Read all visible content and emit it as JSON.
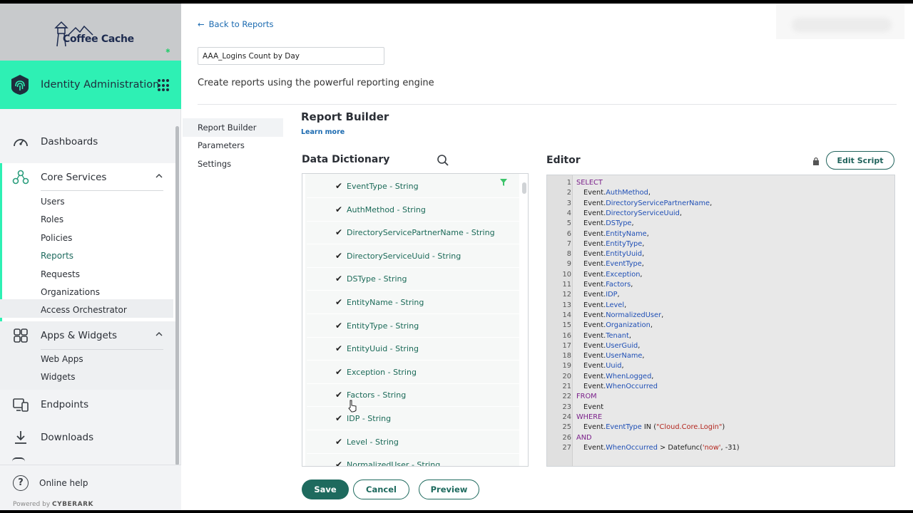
{
  "brand": {
    "logo_text": "Coffee Cache",
    "accent": "#2ef0b4",
    "primary": "#1e6a5e",
    "link": "#1b6ab0"
  },
  "app": {
    "title": "Identity Administration"
  },
  "sidebar": {
    "dashboards": "Dashboards",
    "core_services": {
      "label": "Core Services",
      "items": [
        "Users",
        "Roles",
        "Policies",
        "Reports",
        "Requests",
        "Organizations",
        "Access Orchestrator"
      ],
      "active": "Reports"
    },
    "apps_widgets": {
      "label": "Apps & Widgets",
      "items": [
        "Web Apps",
        "Widgets"
      ]
    },
    "endpoints": "Endpoints",
    "downloads": "Downloads",
    "online_help": "Online help",
    "powered_by": "Powered by",
    "powered_brand": "CYBERARK"
  },
  "main": {
    "back_link": "Back to Reports",
    "report_name": "AAA_Logins Count by Day",
    "subtitle": "Create reports using the powerful reporting engine",
    "tabs": [
      "Report Builder",
      "Parameters",
      "Settings"
    ],
    "active_tab": "Report Builder",
    "builder_title": "Report Builder",
    "learn_more": "Learn more",
    "data_dictionary": {
      "title": "Data Dictionary",
      "fields": [
        "EventType - String",
        "AuthMethod - String",
        "DirectoryServicePartnerName - String",
        "DirectoryServiceUuid - String",
        "DSType - String",
        "EntityName - String",
        "EntityType - String",
        "EntityUuid - String",
        "Exception - String",
        "Factors - String",
        "IDP - String",
        "Level - String",
        "NormalizedUser - String"
      ]
    },
    "editor": {
      "title": "Editor",
      "edit_script": "Edit Script",
      "lines": [
        {
          "n": "1",
          "kw": "SELECT",
          "code": ""
        },
        {
          "n": "2",
          "kw": "",
          "obj": "Event.",
          "fld": "AuthMethod",
          "tail": ","
        },
        {
          "n": "3",
          "kw": "",
          "obj": "Event.",
          "fld": "DirectoryServicePartnerName",
          "tail": ","
        },
        {
          "n": "4",
          "kw": "",
          "obj": "Event.",
          "fld": "DirectoryServiceUuid",
          "tail": ","
        },
        {
          "n": "5",
          "kw": "",
          "obj": "Event.",
          "fld": "DSType",
          "tail": ","
        },
        {
          "n": "6",
          "kw": "",
          "obj": "Event.",
          "fld": "EntityName",
          "tail": ","
        },
        {
          "n": "7",
          "kw": "",
          "obj": "Event.",
          "fld": "EntityType",
          "tail": ","
        },
        {
          "n": "8",
          "kw": "",
          "obj": "Event.",
          "fld": "EntityUuid",
          "tail": ","
        },
        {
          "n": "9",
          "kw": "",
          "obj": "Event.",
          "fld": "EventType",
          "tail": ","
        },
        {
          "n": "10",
          "kw": "",
          "obj": "Event.",
          "fld": "Exception",
          "tail": ","
        },
        {
          "n": "11",
          "kw": "",
          "obj": "Event.",
          "fld": "Factors",
          "tail": ","
        },
        {
          "n": "12",
          "kw": "",
          "obj": "Event.",
          "fld": "IDP",
          "tail": ","
        },
        {
          "n": "13",
          "kw": "",
          "obj": "Event.",
          "fld": "Level",
          "tail": ","
        },
        {
          "n": "14",
          "kw": "",
          "obj": "Event.",
          "fld": "NormalizedUser",
          "tail": ","
        },
        {
          "n": "15",
          "kw": "",
          "obj": "Event.",
          "fld": "Organization",
          "tail": ","
        },
        {
          "n": "16",
          "kw": "",
          "obj": "Event.",
          "fld": "Tenant",
          "tail": ","
        },
        {
          "n": "17",
          "kw": "",
          "obj": "Event.",
          "fld": "UserGuid",
          "tail": ","
        },
        {
          "n": "18",
          "kw": "",
          "obj": "Event.",
          "fld": "UserName",
          "tail": ","
        },
        {
          "n": "19",
          "kw": "",
          "obj": "Event.",
          "fld": "Uuid",
          "tail": ","
        },
        {
          "n": "20",
          "kw": "",
          "obj": "Event.",
          "fld": "WhenLogged",
          "tail": ","
        },
        {
          "n": "21",
          "kw": "",
          "obj": "Event.",
          "fld": "WhenOccurred",
          "tail": ""
        },
        {
          "n": "22",
          "kw": "FROM",
          "code": ""
        },
        {
          "n": "23",
          "kw": "",
          "obj": "Event",
          "fld": "",
          "tail": ""
        },
        {
          "n": "24",
          "kw": "WHERE",
          "code": ""
        },
        {
          "n": "25",
          "kw": "",
          "obj": "Event.",
          "fld": "EventType",
          "tail": " IN (",
          "str": "\"Cloud.Core.Login\"",
          "tail2": ")"
        },
        {
          "n": "26",
          "kw": "AND",
          "code": ""
        },
        {
          "n": "27",
          "kw": "",
          "obj": "Event.",
          "fld": "WhenOccurred",
          "tail": " > Datefunc(",
          "str": "'now'",
          "tail2": ", -31)"
        }
      ]
    },
    "buttons": {
      "save": "Save",
      "cancel": "Cancel",
      "preview": "Preview"
    }
  }
}
